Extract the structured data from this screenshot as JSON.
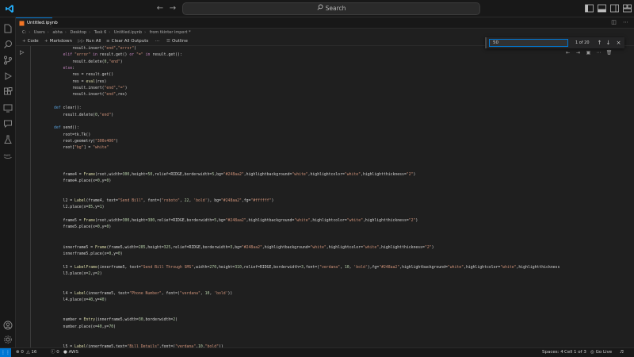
{
  "titlebar": {
    "search_label": "Search",
    "back_icon": "arrow-left-icon",
    "forward_icon": "arrow-right-icon"
  },
  "tab": {
    "label": "Untitled.ipynb"
  },
  "breadcrumb": {
    "parts": [
      "C:",
      "Users",
      "abha",
      "Desktop",
      "Task 6",
      "Untitled.ipynb",
      "from tkinter import *"
    ]
  },
  "toolbar": {
    "code": "Code",
    "markdown": "Markdown",
    "run_all": "Run All",
    "clear_outputs": "Clear All Outputs",
    "outline": "Outline"
  },
  "find": {
    "value": "50",
    "count": "1 of 20"
  },
  "code_lines": [
    {
      "t": "        result.insert(\"end\",\"error\")",
      "cls": ""
    },
    {
      "t": "    elif \"error\" in result.get() or \"=\" in result.get():",
      "cls": ""
    },
    {
      "t": "        result.delete(0,\"end\")",
      "cls": ""
    },
    {
      "t": "    else:",
      "cls": ""
    },
    {
      "t": "        res = result.get()",
      "cls": ""
    },
    {
      "t": "        res = eval(res)",
      "cls": ""
    },
    {
      "t": "        result.insert(\"end\",\"=\")",
      "cls": ""
    },
    {
      "t": "        result.insert(\"end\",res)",
      "cls": ""
    },
    {
      "t": "",
      "cls": ""
    },
    {
      "t": "def clear():",
      "cls": ""
    },
    {
      "t": "    result.delete(0,\"end\")",
      "cls": ""
    },
    {
      "t": "",
      "cls": ""
    },
    {
      "t": "def send():",
      "cls": ""
    },
    {
      "t": "    root=tk.Tk()",
      "cls": ""
    },
    {
      "t": "    root.geometry(\"300x400\")",
      "cls": ""
    },
    {
      "t": "    root[\"bg\"] = \"white\"",
      "cls": ""
    },
    {
      "t": "",
      "cls": ""
    },
    {
      "t": "",
      "cls": ""
    },
    {
      "t": "",
      "cls": ""
    },
    {
      "t": "    frame4 = Frame(root,width=300,height=50,relief=RIDGE,borderwidth=5,bg=\"#248aa2\",highlightbackground=\"white\",highlightcolor=\"white\",highlightthickness=\"2\")",
      "cls": ""
    },
    {
      "t": "    frame4.place(x=0,y=0)",
      "cls": ""
    },
    {
      "t": "",
      "cls": ""
    },
    {
      "t": "",
      "cls": ""
    },
    {
      "t": "    l2 = Label(frame4, text=\"Send Bill\", font=(\"roboto\", 22, 'bold'), bg=\"#248aa2\",fg=\"#ffffff\")",
      "cls": ""
    },
    {
      "t": "    l2.place(x=85,y=1)",
      "cls": ""
    },
    {
      "t": "",
      "cls": ""
    },
    {
      "t": "    frame5 = Frame(root,width=300,height=380,relief=RIDGE,borderwidth=5,bg=\"#248aa2\",highlightbackground=\"white\",highlightcolor=\"white\",highlightthickness=\"2\")",
      "cls": ""
    },
    {
      "t": "    frame5.place(x=0,y=0)",
      "cls": ""
    },
    {
      "t": "",
      "cls": ""
    },
    {
      "t": "",
      "cls": ""
    },
    {
      "t": "    innerframe5 = Frame(frame5,width=285,height=325,relief=RIDGE,borderwidth=3,bg=\"#248aa2\",highlightbackground=\"white\",highlightcolor=\"white\",highlightthickness=\"2\")",
      "cls": ""
    },
    {
      "t": "    innerframe5.place(x=0,y=0)",
      "cls": ""
    },
    {
      "t": "",
      "cls": ""
    },
    {
      "t": "    l3 = LabelFrame(innerframe5, text=\"Send Bill Through SMS\",width=270,height=310,relief=RIDGE,borderwidth=3,font=(\"verdana\", 10, 'bold'),fg=\"#248aa2\",highlightbackground=\"white\",highlightcolor=\"white\",highlightthickness",
      "cls": ""
    },
    {
      "t": "    l3.place(x=2,y=2)",
      "cls": ""
    },
    {
      "t": "",
      "cls": ""
    },
    {
      "t": "",
      "cls": ""
    },
    {
      "t": "    l4 = Label(innerframe5, text=\"Phone Number\", font=(\"verdana\", 10, 'bold'))",
      "cls": ""
    },
    {
      "t": "    l4.place(x=40,y=40)",
      "cls": ""
    },
    {
      "t": "",
      "cls": ""
    },
    {
      "t": "",
      "cls": ""
    },
    {
      "t": "    number = Entry(innerframe5,width=30,borderwidth=2)",
      "cls": ""
    },
    {
      "t": "    number.place(x=40,y=70)",
      "cls": ""
    },
    {
      "t": "",
      "cls": ""
    },
    {
      "t": "",
      "cls": ""
    },
    {
      "t": "    l5 = Label(innerframe5,text=\"Bill Details\",font=(\"verdana\",10,\"bold\"))",
      "cls": ""
    },
    {
      "t": "    l5.place(x=40,y=100)",
      "cls": ""
    }
  ],
  "status": {
    "errors": "0",
    "warnings": "16",
    "info": "0",
    "aws": "AWS",
    "spaces": "Spaces: 4",
    "cell": "Cell 1 of 3",
    "golive": "Go Live"
  },
  "colors": {
    "accent": "#0078d4",
    "keyword": "#569cd6",
    "string": "#ce9178",
    "number": "#b5cea8",
    "function": "#dcdcaa"
  }
}
